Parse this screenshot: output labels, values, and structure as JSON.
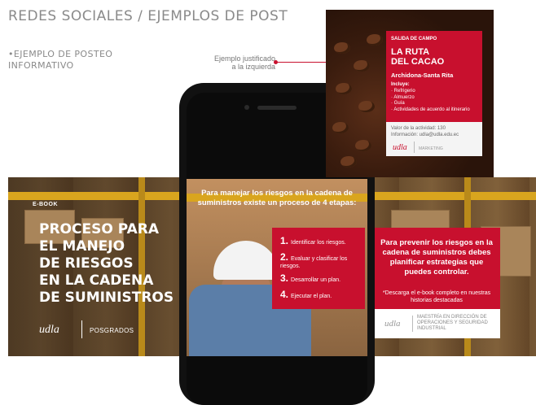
{
  "header": {
    "title": "REDES SOCIALES / EJEMPLOS DE POST",
    "subtitle_line1": "•EJEMPLO DE POSTEO",
    "subtitle_line2": "INFORMATIVO",
    "annotation_line1": "Ejemplo justificado",
    "annotation_line2": "a la izquierda"
  },
  "ebook_slide": {
    "tag": "E-BOOK",
    "title_lines": [
      "PROCESO PARA",
      "EL MANEJO",
      "DE RIESGOS",
      "EN LA CADENA",
      "DE SUMINISTROS"
    ],
    "logo": "udla",
    "brand_label": "POSGRADOS"
  },
  "steps_slide": {
    "headline": "Para manejar los riesgos en la cadena de suministros existe un proceso de 4 etapas:",
    "steps": [
      {
        "num": "1.",
        "text": "Identificar los riesgos."
      },
      {
        "num": "2.",
        "text": "Evaluar y clasificar los riesgos."
      },
      {
        "num": "3.",
        "text": "Desarrollar un plan."
      },
      {
        "num": "4.",
        "text": "Ejecutar el plan."
      }
    ]
  },
  "tips_slide": {
    "text": "Para prevenir los riesgos en la cadena de suministros debes planificar estrategias que puedes controlar.",
    "note": "*Descarga el e-book completo en nuestras historias destacadas",
    "logo": "udla",
    "program": "MAESTRÍA EN DIRECCIÓN DE OPERACIONES Y SEGURIDAD INDUSTRIAL"
  },
  "coffee_post": {
    "tag": "SALIDA DE CAMPO",
    "title_line1": "LA RUTA",
    "title_line2": "DEL CACAO",
    "location": "Archidona-Santa Rita",
    "includes_label": "Incluye:",
    "includes": [
      "· Refrigerio",
      "· Almuerzo",
      "· Guía",
      "· Actividades de acuerdo al itinerario"
    ],
    "value": "Valor de la actividad: 130",
    "info": "Información: udla@udla.edu.ec",
    "logo": "udla",
    "brand_label": "MARKETING"
  },
  "colors": {
    "accent_red": "#c8102e",
    "banner_yellow": "#d9a51e"
  }
}
